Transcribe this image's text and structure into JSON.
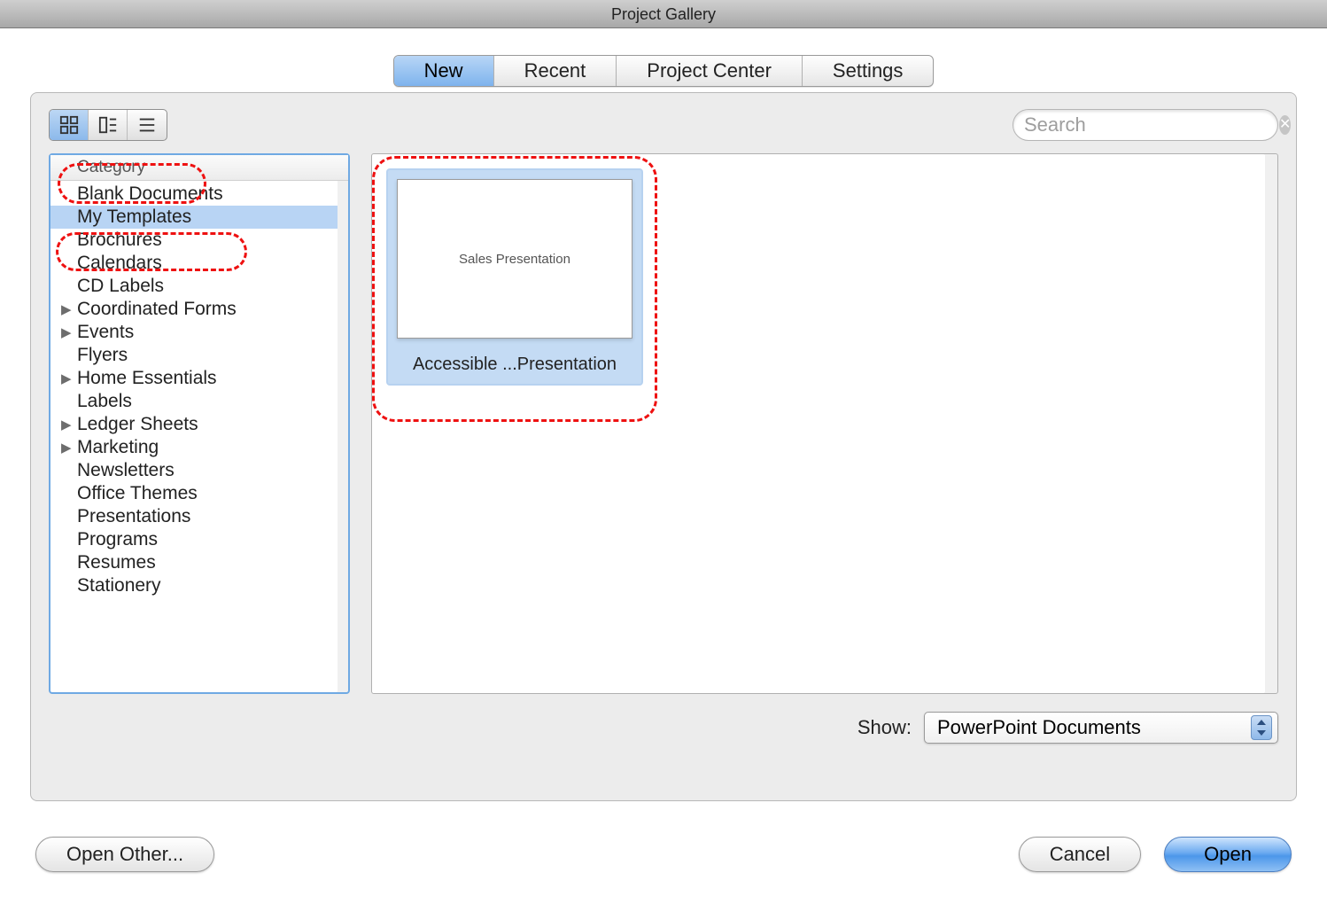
{
  "window": {
    "title": "Project Gallery"
  },
  "tabs": [
    {
      "label": "New",
      "active": true
    },
    {
      "label": "Recent",
      "active": false
    },
    {
      "label": "Project Center",
      "active": false
    },
    {
      "label": "Settings",
      "active": false
    }
  ],
  "search": {
    "placeholder": "Search"
  },
  "sidebar": {
    "header": "Category",
    "items": [
      {
        "label": "Blank Documents",
        "expandable": false,
        "selected": false
      },
      {
        "label": "My Templates",
        "expandable": false,
        "selected": true
      },
      {
        "label": "Brochures",
        "expandable": false,
        "selected": false
      },
      {
        "label": "Calendars",
        "expandable": false,
        "selected": false
      },
      {
        "label": "CD Labels",
        "expandable": false,
        "selected": false
      },
      {
        "label": "Coordinated Forms",
        "expandable": true,
        "selected": false
      },
      {
        "label": "Events",
        "expandable": true,
        "selected": false
      },
      {
        "label": "Flyers",
        "expandable": false,
        "selected": false
      },
      {
        "label": "Home Essentials",
        "expandable": true,
        "selected": false
      },
      {
        "label": "Labels",
        "expandable": false,
        "selected": false
      },
      {
        "label": "Ledger Sheets",
        "expandable": true,
        "selected": false
      },
      {
        "label": "Marketing",
        "expandable": true,
        "selected": false
      },
      {
        "label": "Newsletters",
        "expandable": false,
        "selected": false
      },
      {
        "label": "Office Themes",
        "expandable": false,
        "selected": false
      },
      {
        "label": "Presentations",
        "expandable": false,
        "selected": false
      },
      {
        "label": "Programs",
        "expandable": false,
        "selected": false
      },
      {
        "label": "Resumes",
        "expandable": false,
        "selected": false
      },
      {
        "label": "Stationery",
        "expandable": false,
        "selected": false
      }
    ]
  },
  "templates": [
    {
      "thumb_text": "Sales Presentation",
      "label": "Accessible ...Presentation"
    }
  ],
  "show": {
    "label": "Show:",
    "selected": "PowerPoint Documents"
  },
  "buttons": {
    "open_other": "Open Other...",
    "cancel": "Cancel",
    "open": "Open"
  }
}
